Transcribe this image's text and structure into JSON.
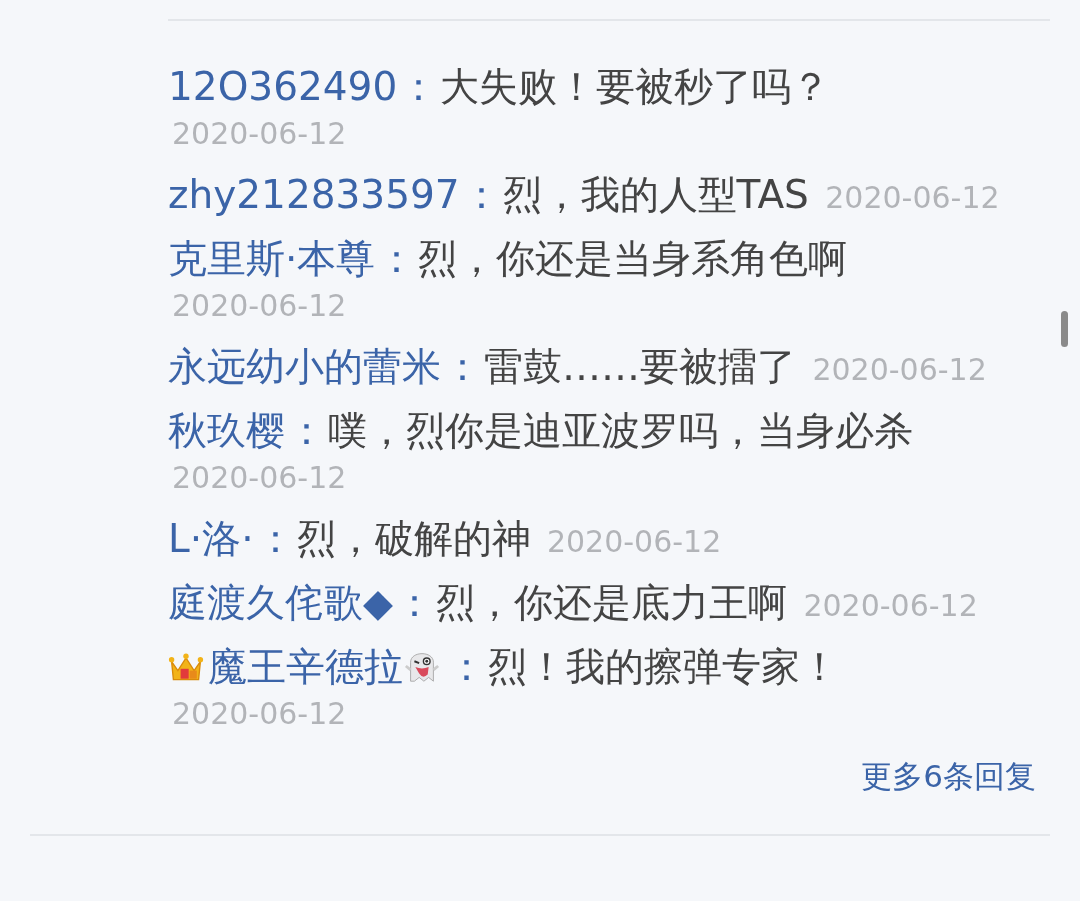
{
  "replies": [
    {
      "user": "12O362490",
      "text": "大失败！要被秒了吗？",
      "date": "2020-06-12"
    },
    {
      "user": "zhy212833597",
      "text": "烈，我的人型TAS",
      "date": "2020-06-12"
    },
    {
      "user": "克里斯·本尊",
      "text": "烈，你还是当身系角色啊",
      "date": "2020-06-12"
    },
    {
      "user": "永远幼小的蕾米",
      "text": "雷鼓……要被擂了",
      "date": "2020-06-12"
    },
    {
      "user": "秋玖樱",
      "text": "噗，烈你是迪亚波罗吗，当身必杀",
      "date": "2020-06-12"
    },
    {
      "user": "L·洛·",
      "text": "烈，破解的神",
      "date": "2020-06-12"
    },
    {
      "user": "庭渡久侘歌◆",
      "text": "烈，你还是底力王啊",
      "date": "2020-06-12"
    },
    {
      "user": "魔王辛德拉",
      "prefix_icon": {
        "kind": "crown"
      },
      "suffix_icon": {
        "kind": "ghost"
      },
      "text": "烈！我的擦弹专家！",
      "date": "2020-06-12"
    }
  ],
  "separator": "：",
  "more_link": "更多6条回复"
}
